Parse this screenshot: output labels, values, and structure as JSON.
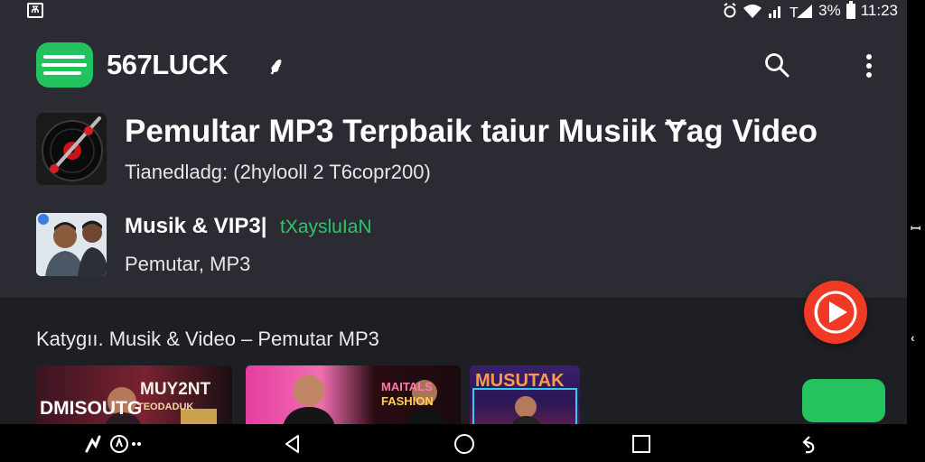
{
  "status_bar": {
    "left_icon": "Ѫ",
    "battery": "3%",
    "time": "11:23",
    "icons": [
      "alarm-icon",
      "wifi-icon",
      "signal-icon",
      "battery-icon"
    ]
  },
  "app_bar": {
    "brand": "567LUCK",
    "share_glyph": "⸙",
    "icons": [
      "logo-icon",
      "share-icon",
      "search-icon",
      "more-icon"
    ]
  },
  "list": [
    {
      "title": "Pemultar MP3 Terpbaik taiur Musiik Ɏag Video",
      "subtitle": "Tianedladg: (2hylooll 2 T6copr200)"
    },
    {
      "title": "Musik & VIP3|",
      "tag": "tXaysluIaN",
      "subtitle": "Pemutar, MP3"
    }
  ],
  "section": {
    "title": "Katygıı. Musik & Video – Pemutar MP3"
  },
  "cards": [
    {
      "label": "MUY2NT",
      "label2": "DMISOUTG",
      "label3": "TEODADUK"
    },
    {
      "label": "MAITALS",
      "label2": "FASHION"
    },
    {
      "label": "MUSUTAK"
    }
  ],
  "colors": {
    "background": "#2b2c33",
    "accent_green": "#22c35e",
    "fab_red": "#f03a26",
    "tag_green": "#2dc46b"
  },
  "navbar": {
    "icons": [
      "assistant-icon",
      "media-icon",
      "back-icon",
      "home-icon",
      "recents-icon",
      "rotate-icon"
    ]
  }
}
